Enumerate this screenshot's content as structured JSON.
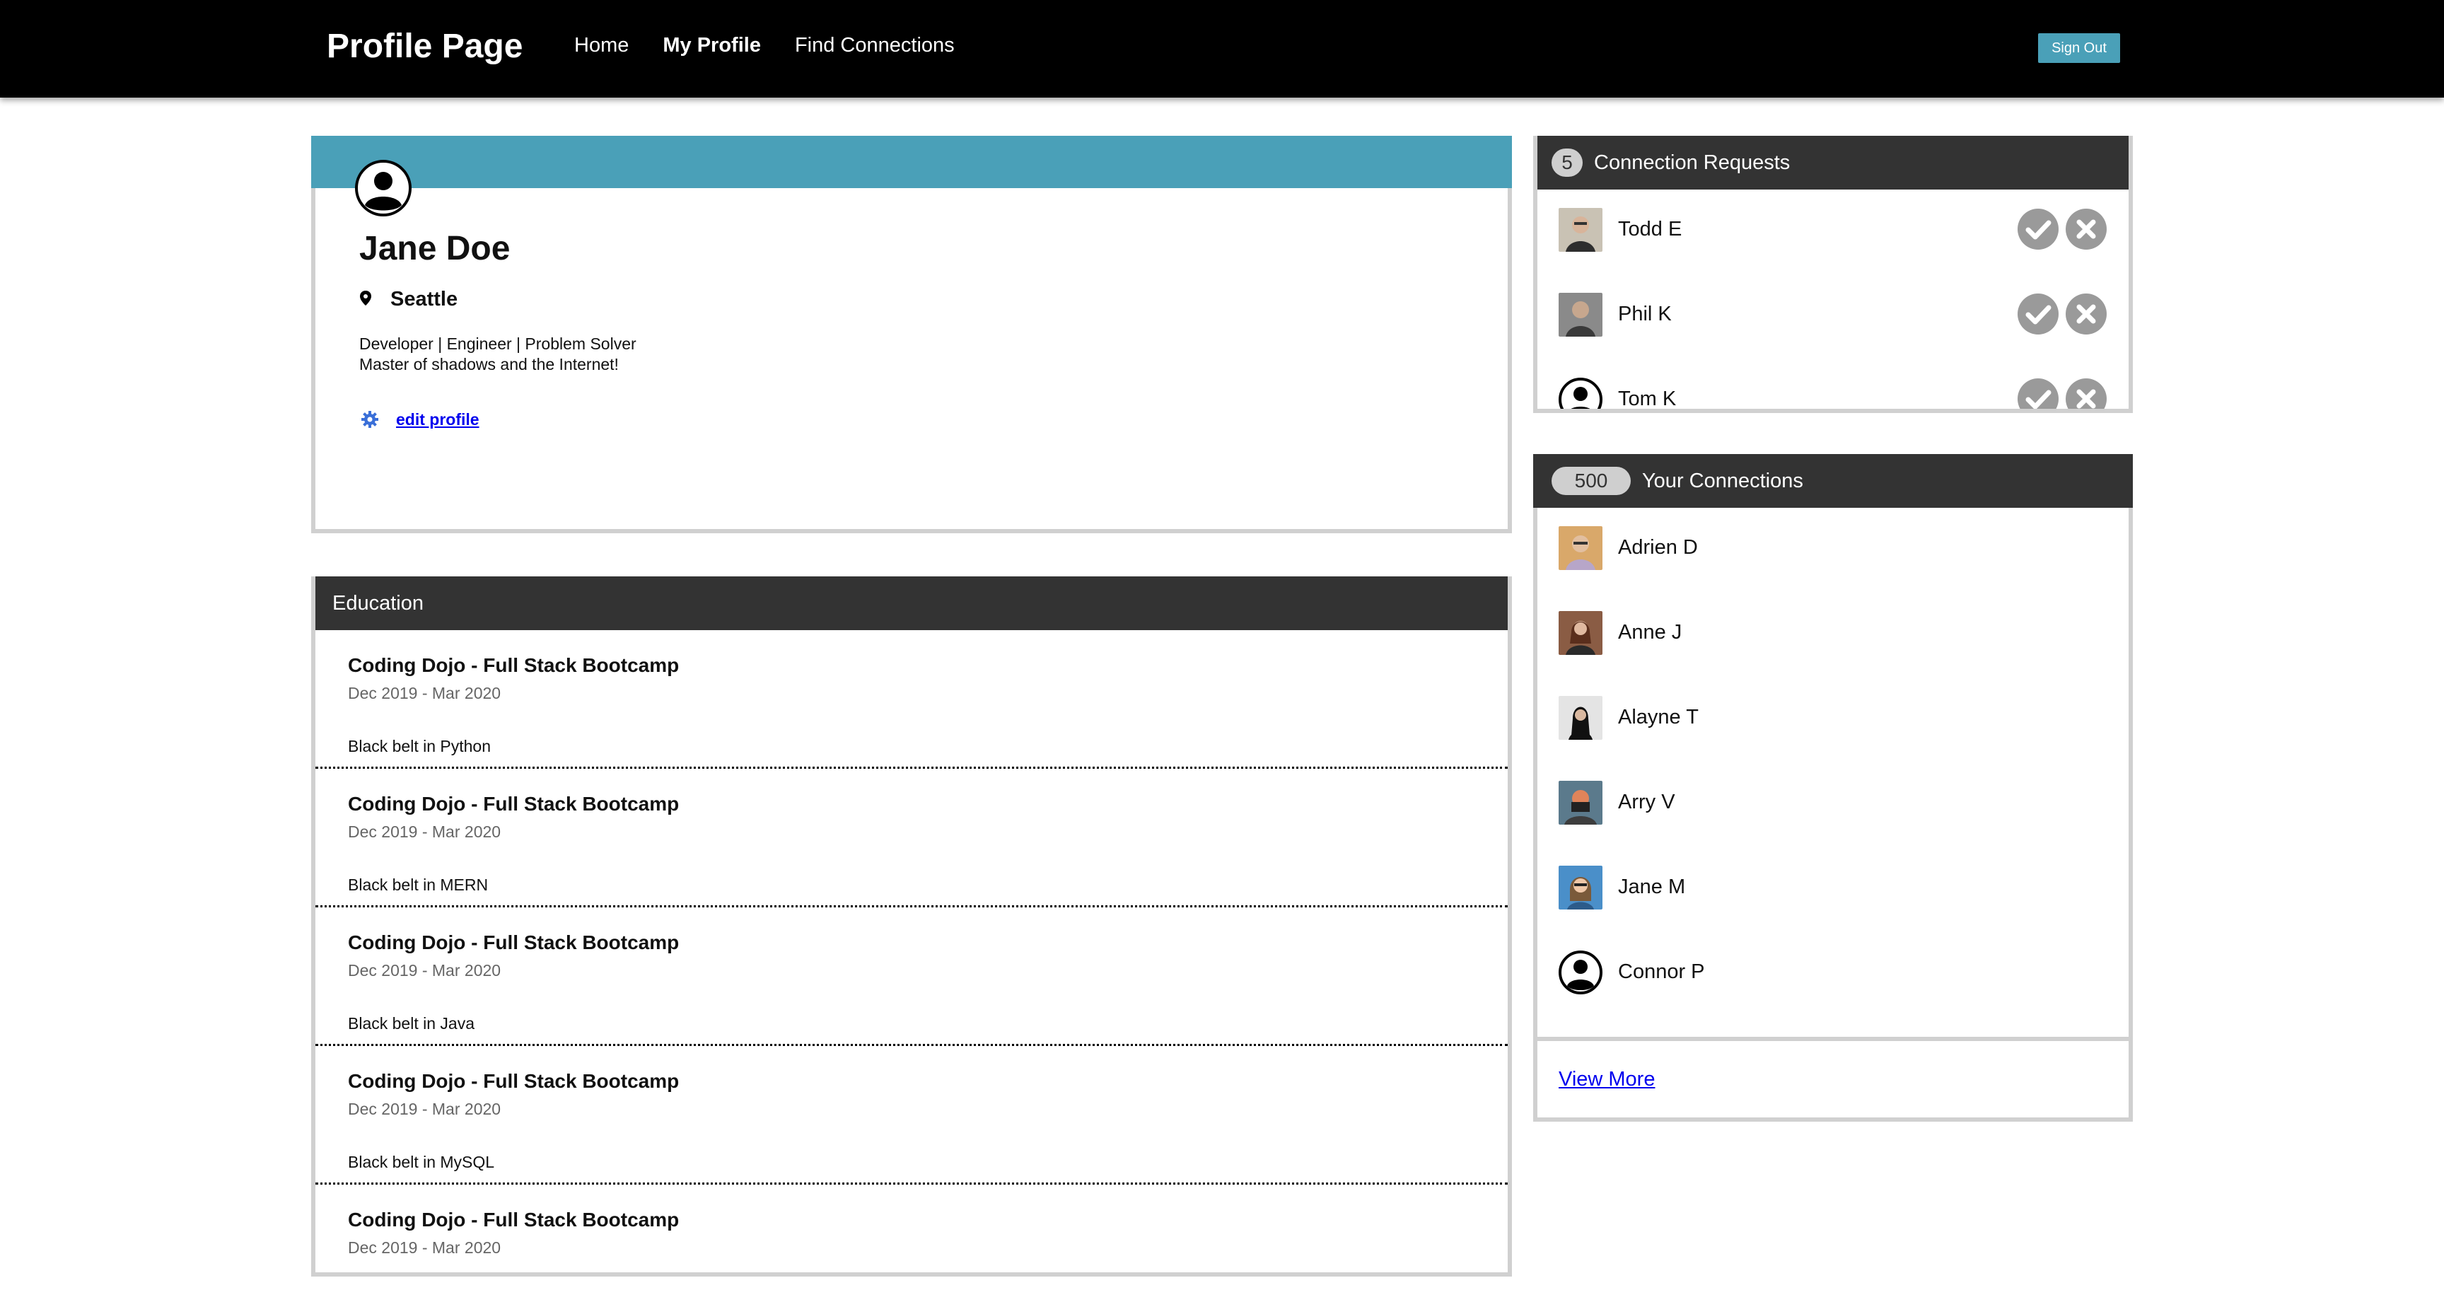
{
  "nav": {
    "brand": "Profile Page",
    "links": [
      {
        "label": "Home",
        "active": false
      },
      {
        "label": "My Profile",
        "active": true
      },
      {
        "label": "Find Connections",
        "active": false
      }
    ],
    "sign_out": "Sign Out"
  },
  "profile": {
    "name": "Jane Doe",
    "location": "Seattle",
    "bio_line1": "Developer | Engineer | Problem Solver",
    "bio_line2": "Master of shadows and the Internet!",
    "edit_label": "edit profile",
    "banner_color": "#4aa0b8"
  },
  "education": {
    "header": "Education",
    "items": [
      {
        "school": "Coding Dojo - Full Stack Bootcamp",
        "dates": "Dec 2019 - Mar 2020",
        "desc": "Black belt in Python"
      },
      {
        "school": "Coding Dojo - Full Stack Bootcamp",
        "dates": "Dec 2019 - Mar 2020",
        "desc": "Black belt in MERN"
      },
      {
        "school": "Coding Dojo - Full Stack Bootcamp",
        "dates": "Dec 2019 - Mar 2020",
        "desc": "Black belt in Java"
      },
      {
        "school": "Coding Dojo - Full Stack Bootcamp",
        "dates": "Dec 2019 - Mar 2020",
        "desc": "Black belt in MySQL"
      },
      {
        "school": "Coding Dojo - Full Stack Bootcamp",
        "dates": "Dec 2019 - Mar 2020",
        "desc": ""
      }
    ]
  },
  "requests": {
    "count": "5",
    "header": "Connection Requests",
    "people": [
      {
        "name": "Todd E",
        "photo": "photo"
      },
      {
        "name": "Phil K",
        "photo": "photo"
      },
      {
        "name": "Tom K",
        "photo": "default-avatar"
      }
    ]
  },
  "connections": {
    "count": "500",
    "header": "Your Connections",
    "people": [
      {
        "name": "Adrien D",
        "photo": "photo"
      },
      {
        "name": "Anne J",
        "photo": "photo"
      },
      {
        "name": "Alayne T",
        "photo": "photo"
      },
      {
        "name": "Arry V",
        "photo": "photo"
      },
      {
        "name": "Jane M",
        "photo": "photo"
      },
      {
        "name": "Connor P",
        "photo": "default-avatar"
      }
    ],
    "view_more": "View More"
  },
  "colors": {
    "header_dark": "#333333",
    "accent": "#4aa0b8",
    "link": "#0000ee",
    "action_gray": "#9a9a9a"
  }
}
